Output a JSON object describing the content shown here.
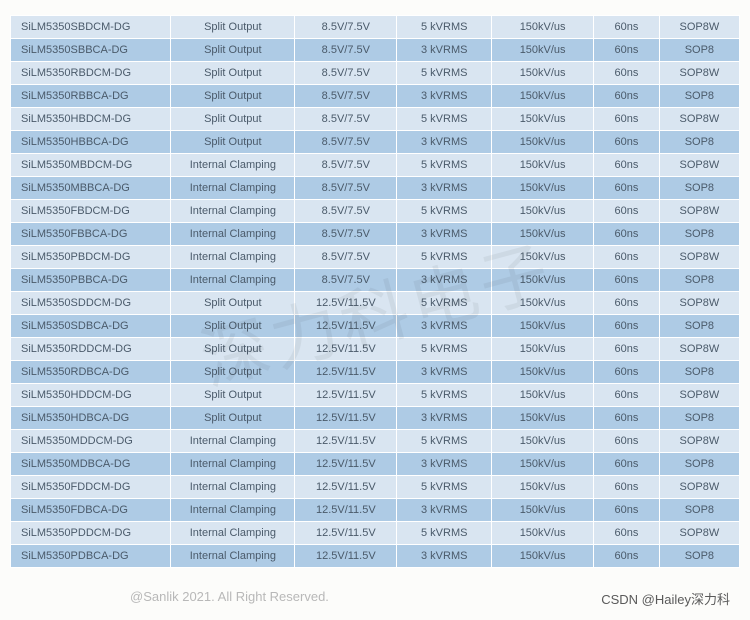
{
  "watermark": "深力科电子",
  "footer_left": "@Sanlik 2021. All Right Reserved.",
  "footer_right": "CSDN @Hailey深力科",
  "columns": [
    "partno",
    "output",
    "voltage",
    "iso",
    "slew",
    "delay",
    "package"
  ],
  "rows": [
    {
      "shade": "light",
      "partno": "SiLM5350SBDCM-DG",
      "output": "Split Output",
      "voltage": "8.5V/7.5V",
      "iso": "5 kVRMS",
      "slew": "150kV/us",
      "delay": "60ns",
      "package": "SOP8W"
    },
    {
      "shade": "dark",
      "partno": "SiLM5350SBBCA-DG",
      "output": "Split Output",
      "voltage": "8.5V/7.5V",
      "iso": "3 kVRMS",
      "slew": "150kV/us",
      "delay": "60ns",
      "package": "SOP8"
    },
    {
      "shade": "light",
      "partno": "SiLM5350RBDCM-DG",
      "output": "Split Output",
      "voltage": "8.5V/7.5V",
      "iso": "5 kVRMS",
      "slew": "150kV/us",
      "delay": "60ns",
      "package": "SOP8W"
    },
    {
      "shade": "dark",
      "partno": "SiLM5350RBBCA-DG",
      "output": "Split Output",
      "voltage": "8.5V/7.5V",
      "iso": "3 kVRMS",
      "slew": "150kV/us",
      "delay": "60ns",
      "package": "SOP8"
    },
    {
      "shade": "light",
      "partno": "SiLM5350HBDCM-DG",
      "output": "Split Output",
      "voltage": "8.5V/7.5V",
      "iso": "5 kVRMS",
      "slew": "150kV/us",
      "delay": "60ns",
      "package": "SOP8W"
    },
    {
      "shade": "dark",
      "partno": "SiLM5350HBBCA-DG",
      "output": "Split Output",
      "voltage": "8.5V/7.5V",
      "iso": "3 kVRMS",
      "slew": "150kV/us",
      "delay": "60ns",
      "package": "SOP8"
    },
    {
      "shade": "light",
      "partno": "SiLM5350MBDCM-DG",
      "output": "Internal Clamping",
      "voltage": "8.5V/7.5V",
      "iso": "5 kVRMS",
      "slew": "150kV/us",
      "delay": "60ns",
      "package": "SOP8W"
    },
    {
      "shade": "dark",
      "partno": "SiLM5350MBBCA-DG",
      "output": "Internal Clamping",
      "voltage": "8.5V/7.5V",
      "iso": "3 kVRMS",
      "slew": "150kV/us",
      "delay": "60ns",
      "package": "SOP8"
    },
    {
      "shade": "light",
      "partno": "SiLM5350FBDCM-DG",
      "output": "Internal Clamping",
      "voltage": "8.5V/7.5V",
      "iso": "5 kVRMS",
      "slew": "150kV/us",
      "delay": "60ns",
      "package": "SOP8W"
    },
    {
      "shade": "dark",
      "partno": "SiLM5350FBBCA-DG",
      "output": "Internal Clamping",
      "voltage": "8.5V/7.5V",
      "iso": "3 kVRMS",
      "slew": "150kV/us",
      "delay": "60ns",
      "package": "SOP8"
    },
    {
      "shade": "light",
      "partno": "SiLM5350PBDCM-DG",
      "output": "Internal Clamping",
      "voltage": "8.5V/7.5V",
      "iso": "5 kVRMS",
      "slew": "150kV/us",
      "delay": "60ns",
      "package": "SOP8W"
    },
    {
      "shade": "dark",
      "partno": "SiLM5350PBBCA-DG",
      "output": "Internal Clamping",
      "voltage": "8.5V/7.5V",
      "iso": "3 kVRMS",
      "slew": "150kV/us",
      "delay": "60ns",
      "package": "SOP8"
    },
    {
      "shade": "light",
      "partno": "SiLM5350SDDCM-DG",
      "output": "Split Output",
      "voltage": "12.5V/11.5V",
      "iso": "5 kVRMS",
      "slew": "150kV/us",
      "delay": "60ns",
      "package": "SOP8W"
    },
    {
      "shade": "dark",
      "partno": "SiLM5350SDBCA-DG",
      "output": "Split Output",
      "voltage": "12.5V/11.5V",
      "iso": "3 kVRMS",
      "slew": "150kV/us",
      "delay": "60ns",
      "package": "SOP8"
    },
    {
      "shade": "light",
      "partno": "SiLM5350RDDCM-DG",
      "output": "Split Output",
      "voltage": "12.5V/11.5V",
      "iso": "5 kVRMS",
      "slew": "150kV/us",
      "delay": "60ns",
      "package": "SOP8W"
    },
    {
      "shade": "dark",
      "partno": "SiLM5350RDBCA-DG",
      "output": "Split Output",
      "voltage": "12.5V/11.5V",
      "iso": "3 kVRMS",
      "slew": "150kV/us",
      "delay": "60ns",
      "package": "SOP8"
    },
    {
      "shade": "light",
      "partno": "SiLM5350HDDCM-DG",
      "output": "Split Output",
      "voltage": "12.5V/11.5V",
      "iso": "5 kVRMS",
      "slew": "150kV/us",
      "delay": "60ns",
      "package": "SOP8W"
    },
    {
      "shade": "dark",
      "partno": "SiLM5350HDBCA-DG",
      "output": "Split Output",
      "voltage": "12.5V/11.5V",
      "iso": "3 kVRMS",
      "slew": "150kV/us",
      "delay": "60ns",
      "package": "SOP8"
    },
    {
      "shade": "light",
      "partno": "SiLM5350MDDCM-DG",
      "output": "Internal Clamping",
      "voltage": "12.5V/11.5V",
      "iso": "5 kVRMS",
      "slew": "150kV/us",
      "delay": "60ns",
      "package": "SOP8W"
    },
    {
      "shade": "dark",
      "partno": "SiLM5350MDBCA-DG",
      "output": "Internal Clamping",
      "voltage": "12.5V/11.5V",
      "iso": "3 kVRMS",
      "slew": "150kV/us",
      "delay": "60ns",
      "package": "SOP8"
    },
    {
      "shade": "light",
      "partno": "SiLM5350FDDCM-DG",
      "output": "Internal Clamping",
      "voltage": "12.5V/11.5V",
      "iso": "5 kVRMS",
      "slew": "150kV/us",
      "delay": "60ns",
      "package": "SOP8W"
    },
    {
      "shade": "dark",
      "partno": "SiLM5350FDBCA-DG",
      "output": "Internal Clamping",
      "voltage": "12.5V/11.5V",
      "iso": "3 kVRMS",
      "slew": "150kV/us",
      "delay": "60ns",
      "package": "SOP8"
    },
    {
      "shade": "light",
      "partno": "SiLM5350PDDCM-DG",
      "output": "Internal Clamping",
      "voltage": "12.5V/11.5V",
      "iso": "5 kVRMS",
      "slew": "150kV/us",
      "delay": "60ns",
      "package": "SOP8W"
    },
    {
      "shade": "dark",
      "partno": "SiLM5350PDBCA-DG",
      "output": "Internal Clamping",
      "voltage": "12.5V/11.5V",
      "iso": "3 kVRMS",
      "slew": "150kV/us",
      "delay": "60ns",
      "package": "SOP8"
    }
  ],
  "col_widths": [
    "22%",
    "17%",
    "14%",
    "13%",
    "14%",
    "9%",
    "11%"
  ]
}
